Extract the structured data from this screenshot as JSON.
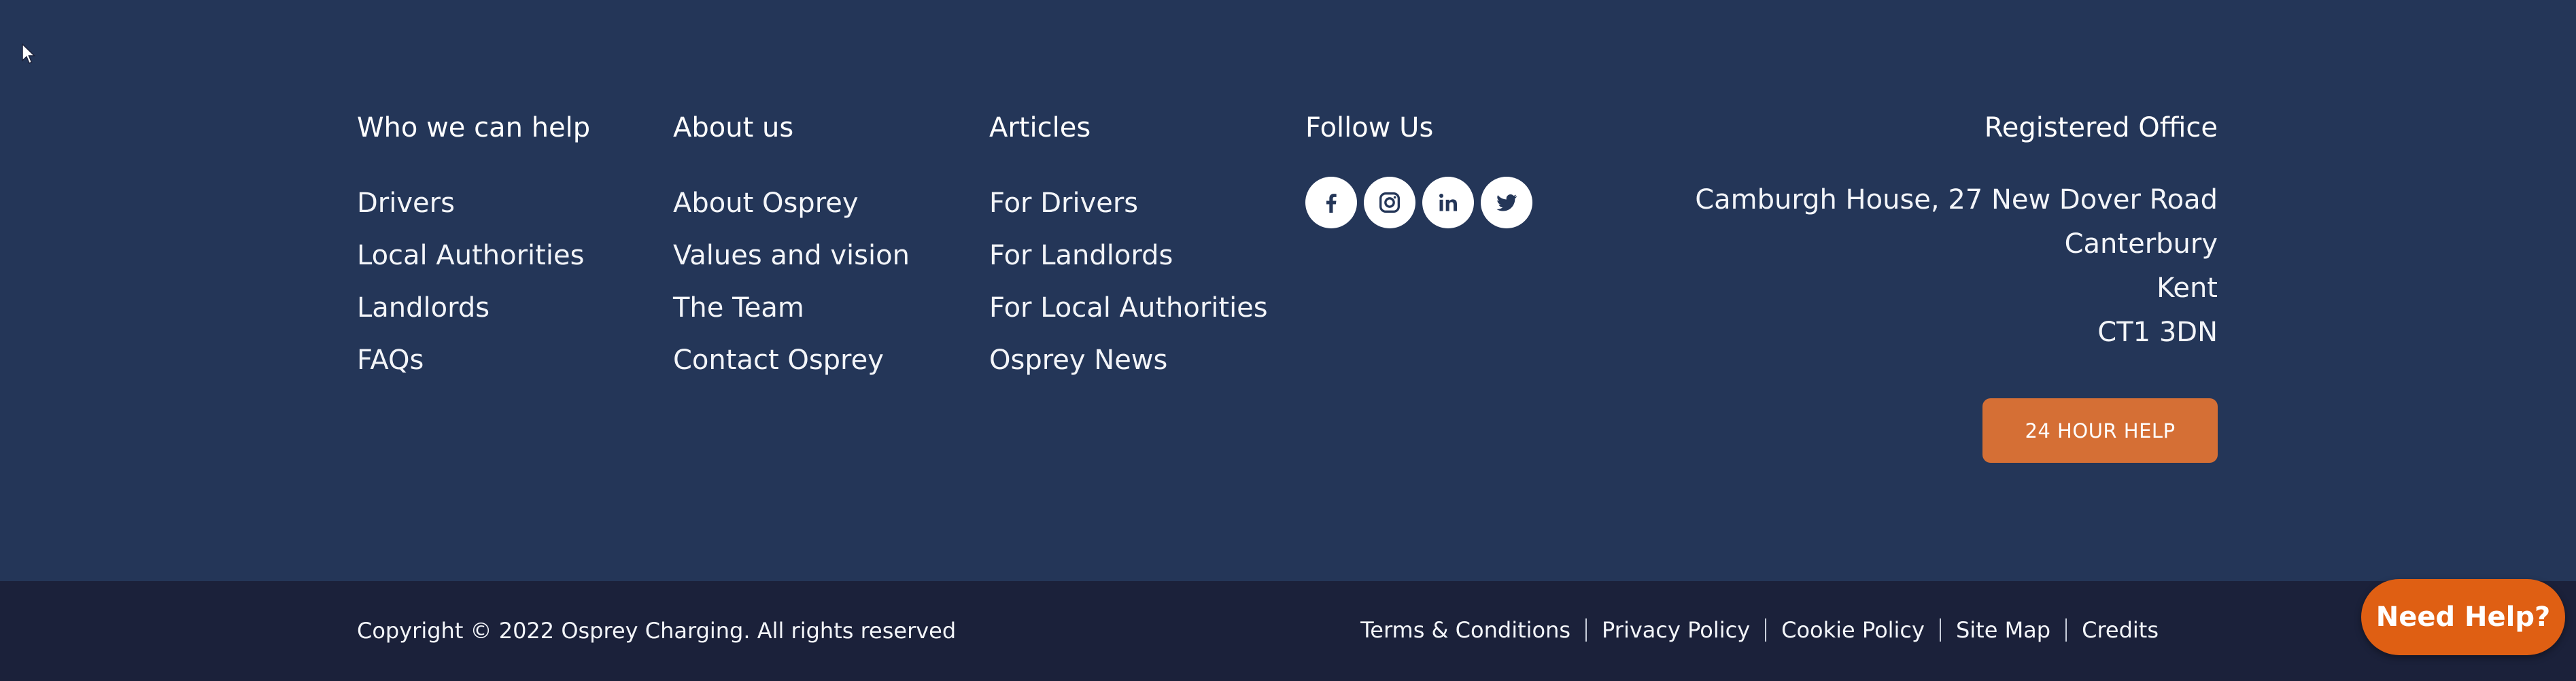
{
  "colors": {
    "footer_bg": "#243658",
    "bottom_bar_bg": "#1b213a",
    "accent_button": "#d56f35",
    "need_help_button": "#df5f13",
    "icon_color": "#243658"
  },
  "columns": [
    {
      "heading": "Who we can help",
      "links": [
        "Drivers",
        "Local Authorities",
        "Landlords",
        "FAQs"
      ]
    },
    {
      "heading": "About us",
      "links": [
        "About Osprey",
        "Values and vision",
        "The Team",
        "Contact Osprey"
      ]
    },
    {
      "heading": "Articles",
      "links": [
        "For Drivers",
        "For Landlords",
        "For Local Authorities",
        "Osprey News"
      ]
    }
  ],
  "follow": {
    "heading": "Follow Us",
    "icons": [
      "facebook-icon",
      "instagram-icon",
      "linkedin-icon",
      "twitter-icon"
    ]
  },
  "office": {
    "heading": "Registered Office",
    "lines": [
      "Camburgh House, 27 New Dover Road",
      "Canterbury",
      "Kent",
      "CT1 3DN"
    ],
    "help_button": "24 HOUR HELP"
  },
  "bottom": {
    "copyright": "Copyright © 2022 Osprey Charging. All rights reserved",
    "links": [
      "Terms & Conditions",
      "Privacy Policy",
      "Cookie Policy",
      "Site Map",
      "Credits"
    ]
  },
  "need_help": "Need Help?"
}
